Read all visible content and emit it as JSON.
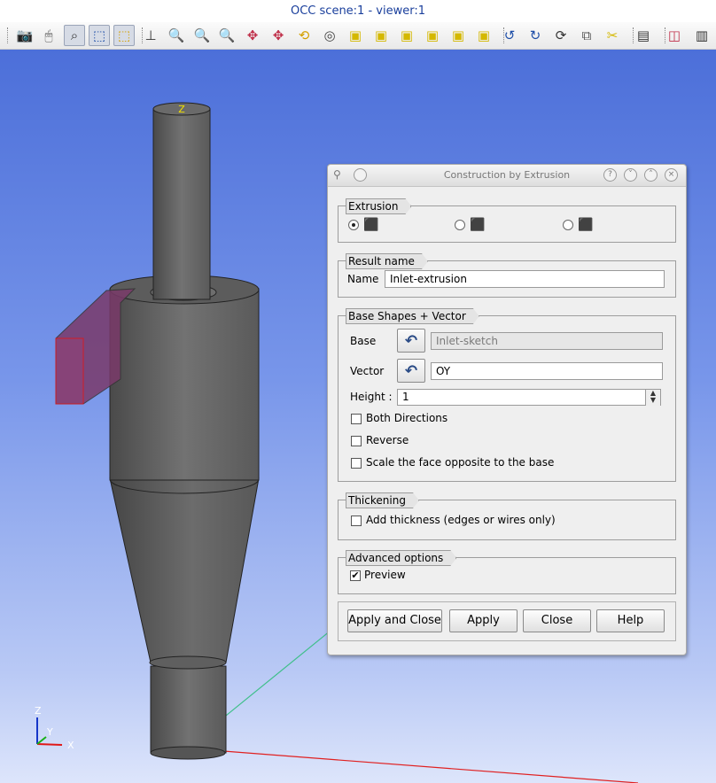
{
  "window": {
    "title": "OCC scene:1 - viewer:1"
  },
  "toolbar": {
    "buttons": [
      {
        "name": "dump-view-icon",
        "glyph": "📷"
      },
      {
        "name": "mouse-interaction-icon",
        "glyph": "🖱"
      },
      {
        "name": "dynamic-selection-icon",
        "glyph": "⌕"
      },
      {
        "name": "rectangle-selection-icon",
        "glyph": "⬚"
      },
      {
        "name": "polyline-selection-icon",
        "glyph": "⬚"
      },
      {
        "name": "trihedron-icon",
        "glyph": "⊥"
      },
      {
        "name": "zoom-icon",
        "glyph": "🔍"
      },
      {
        "name": "window-zoom-icon",
        "glyph": "🔍"
      },
      {
        "name": "fit-all-icon",
        "glyph": "🔍"
      },
      {
        "name": "pan-icon",
        "glyph": "✥"
      },
      {
        "name": "global-pan-icon",
        "glyph": "✥"
      },
      {
        "name": "rotate-icon",
        "glyph": "⟲"
      },
      {
        "name": "rotation-point-icon",
        "glyph": "◎"
      },
      {
        "name": "front-view-icon",
        "glyph": "▣"
      },
      {
        "name": "back-view-icon",
        "glyph": "▣"
      },
      {
        "name": "top-view-icon",
        "glyph": "▣"
      },
      {
        "name": "bottom-view-icon",
        "glyph": "▣"
      },
      {
        "name": "left-view-icon",
        "glyph": "▣"
      },
      {
        "name": "right-view-icon",
        "glyph": "▣"
      },
      {
        "name": "rotate-counterclockwise-icon",
        "glyph": "↺"
      },
      {
        "name": "rotate-clockwise-icon",
        "glyph": "↻"
      },
      {
        "name": "reset-view-icon",
        "glyph": "⟳"
      },
      {
        "name": "clone-view-icon",
        "glyph": "⧉"
      },
      {
        "name": "clipping-icon",
        "glyph": "✂"
      },
      {
        "name": "graduated-axes-icon",
        "glyph": "▤"
      },
      {
        "name": "stereo-view-icon",
        "glyph": "◫"
      },
      {
        "name": "toggle-view-icon",
        "glyph": "▥"
      }
    ]
  },
  "viewport": {
    "top_label": "Z",
    "axes": {
      "z": "Z",
      "y": "Y",
      "x": "X"
    }
  },
  "dialog": {
    "title": "Construction by Extrusion",
    "extrusion": {
      "label": "Extrusion",
      "options": [
        "base-vector",
        "dx-dy-dz",
        "2-points"
      ],
      "selected": 0
    },
    "result": {
      "label": "Result name",
      "name_label": "Name",
      "name_value": "Inlet-extrusion"
    },
    "base_shapes": {
      "label": "Base Shapes + Vector",
      "base_label": "Base",
      "base_value": "Inlet-sketch",
      "vector_label": "Vector",
      "vector_value": "OY",
      "height_label": "Height :",
      "height_value": "1",
      "both_directions": "Both Directions",
      "reverse": "Reverse",
      "scale_face": "Scale the face opposite to the base"
    },
    "thickening": {
      "label": "Thickening",
      "add_thickness": "Add thickness (edges or wires only)"
    },
    "advanced": {
      "label": "Advanced options",
      "preview": "Preview",
      "preview_checked": true
    },
    "buttons": {
      "apply_close": "Apply and Close",
      "apply": "Apply",
      "close": "Close",
      "help": "Help"
    }
  },
  "colors": {
    "title_text": "#1a3f9c",
    "axis_x": "#e01818",
    "axis_y": "#18b018",
    "axis_z": "#1535c8",
    "inlet_face": "#7a3a6a"
  }
}
